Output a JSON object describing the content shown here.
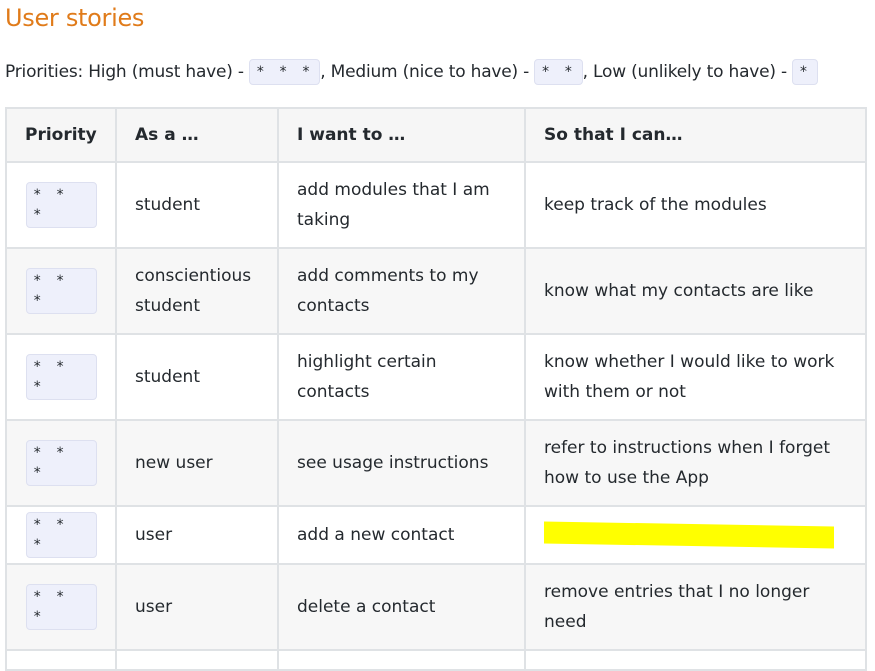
{
  "heading": "User stories",
  "legend": {
    "prefix": "Priorities: High (must have) - ",
    "high": "* * *",
    "sep1": ", Medium (nice to have) - ",
    "medium": "* *",
    "sep2": ", Low (unlikely to have) - ",
    "low": "*"
  },
  "table": {
    "headers": [
      "Priority",
      "As a …",
      "I want to …",
      "So that I can…"
    ],
    "rows": [
      {
        "priority": "* * *",
        "as_a": "student",
        "want": "add modules that I am taking",
        "so_that": "keep track of the modules"
      },
      {
        "priority": "* * *",
        "as_a": "conscientious student",
        "want": "add comments to my contacts",
        "so_that": "know what my contacts are like"
      },
      {
        "priority": "* * *",
        "as_a": "student",
        "want": "highlight certain contacts",
        "so_that": "know whether I would like to work with them or not"
      },
      {
        "priority": "* * *",
        "as_a": "new user",
        "want": "see usage instructions",
        "so_that": "refer to instructions when I forget how to use the App"
      },
      {
        "priority": "* * *",
        "as_a": "user",
        "want": "add a new contact",
        "so_that": ""
      },
      {
        "priority": "* * *",
        "as_a": "user",
        "want": "delete a contact",
        "so_that": "remove entries that I no longer need"
      }
    ]
  },
  "colors": {
    "heading": "#e07b1a",
    "code_bg": "#eef0fb",
    "highlight": "#ffff00"
  }
}
